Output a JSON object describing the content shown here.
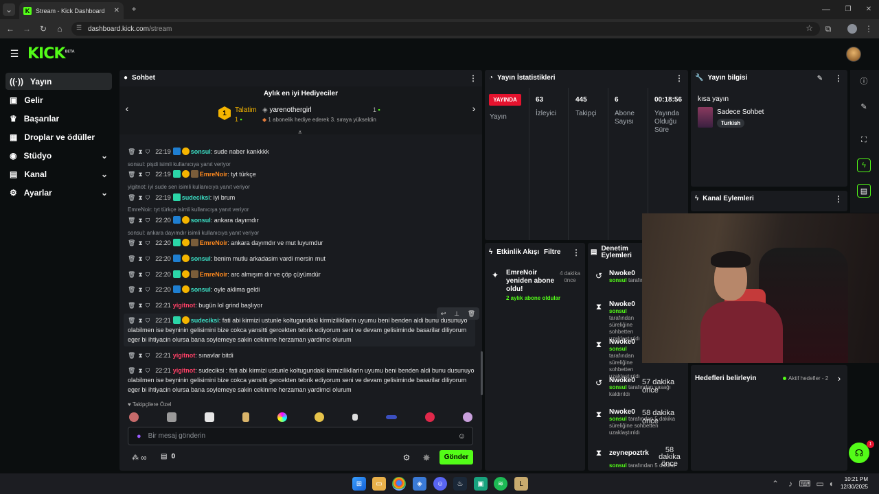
{
  "browser": {
    "tab_title": "Stream - Kick Dashboard",
    "url_host": "dashboard.kick.com",
    "url_path": "/stream"
  },
  "app": {
    "logo": "KICK",
    "logo_tag": "BETA"
  },
  "sidebar": {
    "items": [
      {
        "label": "Yayın",
        "icon": "broadcast-icon"
      },
      {
        "label": "Gelir",
        "icon": "revenue-icon"
      },
      {
        "label": "Başarılar",
        "icon": "trophy-icon"
      },
      {
        "label": "Droplar ve ödüller",
        "icon": "gift-icon"
      },
      {
        "label": "Stüdyo",
        "icon": "studio-icon"
      },
      {
        "label": "Kanal",
        "icon": "channel-icon"
      },
      {
        "label": "Ayarlar",
        "icon": "gear-icon"
      }
    ]
  },
  "chat": {
    "title": "Sohbet",
    "gifters_title": "Aylık en iyi Hediyeciler",
    "gifter1_name": "Talatim",
    "gifter1_count": "1",
    "gifter1_rank": "1",
    "gifter2_name": "yarenothergirl",
    "gifter2_count": "1",
    "gifter2_note": "1 abonelik hediye ederek 3. sıraya yükseldin",
    "messages": [
      {
        "time": "22:19",
        "user": "sonsul",
        "color": "teal",
        "text": ": sude naber kankkkk"
      },
      {
        "reply": "sonsul: pişdi isimli kullanıcıya yanıt veriyor"
      },
      {
        "time": "22:19",
        "user": "EmreNoir",
        "color": "orange",
        "text": ": tyt türkçe"
      },
      {
        "reply": "yigitnot: iyi sude sen isimli kullanıcıya yanıt veriyor"
      },
      {
        "time": "22:19",
        "user": "sudeciksi",
        "color": "teal",
        "text": ": iyi brum"
      },
      {
        "reply": "EmreNoir: tyt türkçe isimli kullanıcıya yanıt veriyor"
      },
      {
        "time": "22:20",
        "user": "sonsul",
        "color": "teal",
        "text": ": ankara dayımdır"
      },
      {
        "reply": "sonsul: ankara dayımdır isimli kullanıcıya yanıt veriyor"
      },
      {
        "time": "22:20",
        "user": "EmreNoir",
        "color": "orange",
        "text": ": ankara dayımdır ve mut luyumdur"
      },
      {
        "time": "22:20",
        "user": "sonsul",
        "color": "teal",
        "text": ": benim mutlu arkadasim vardi mersin mut"
      },
      {
        "time": "22:20",
        "user": "EmreNoir",
        "color": "orange",
        "text": ": arc almışım dır ve çöp çüyümdür"
      },
      {
        "time": "22:20",
        "user": "sonsul",
        "color": "teal",
        "text": ": oyle aklima geldi"
      },
      {
        "time": "22:21",
        "user": "yigitnot",
        "color": "red",
        "text": ": bugün lol grind başlıyor"
      },
      {
        "time": "22:21",
        "user": "sudeciksi",
        "color": "teal",
        "text": ": fati abi kirmizi ustunle koltugundaki kirmizilikllarin uyumu beni benden aldi bunu dusunuyo olabilmen ise beyninin gelisimini bize cokca yansitti gercekten tebrik ediyorum seni ve devam gelisiminde basarilar diliyorum eger bi ihtiyacin olursa bana soylemeye sakin cekinme herzaman yardimci olurum"
      },
      {
        "time": "22:21",
        "user": "yigitnot",
        "color": "red",
        "text": ": sınavlar bitdi"
      },
      {
        "time": "22:21",
        "user": "yigitnot",
        "color": "red",
        "text": ": sudeciksi : fati abi kirmizi ustunle koltugundaki kirmizilikllarin uyumu beni benden aldi bunu dusunuyo olabilmen ise beyninin gelisimini bize cokca yansitti gercekten tebrik ediyorum seni ve devam gelisiminde basarilar diliyorum eger bi ihtiyacin olursa bana soylemeye sakin cekinme herzaman yardimci olurum"
      }
    ],
    "emote_section": "Takipçilere Özel",
    "input_placeholder": "Bir mesaj gönderin",
    "points": "∞",
    "store_count": "0",
    "send_label": "Gönder"
  },
  "stats": {
    "title": "Yayın İstatistikleri",
    "live_label": "YAYINDA",
    "live_sub": "Yayın",
    "viewers_value": "63",
    "viewers_label": "İzleyici",
    "followers_value": "445",
    "followers_label": "Takipçi",
    "subs_value": "6",
    "subs_label": "Abone Sayısı",
    "uptime_value": "00:18:56",
    "uptime_label": "Yayında Olduğu Süre"
  },
  "stream_info": {
    "title": "Yayın bilgisi",
    "stream_title": "kısa yayın",
    "category": "Sadece Sohbet",
    "language": "Turkish"
  },
  "activity": {
    "title": "Etkinlik Akışı",
    "filter_label": "Filtre",
    "event_user": "EmreNoir",
    "event_text": "yeniden abone oldu!",
    "event_sub": "2 aylık abone oldular",
    "event_time": "4 dakika önce"
  },
  "moderation": {
    "title": "Denetim Eylemleri",
    "items": [
      {
        "name": "Nwoke0",
        "text_user": "sonsul",
        "text": "tarafından kaldırıldı",
        "when": ""
      },
      {
        "name": "Nwoke0",
        "text_user": "sonsul",
        "text": "tarafından süreliğine sohbetten uzaklaştırıldı",
        "when": ""
      },
      {
        "name": "Nwoke0",
        "text_user": "sonsul",
        "text": "tarafından süreliğine sohbetten uzaklaştırıldı",
        "when": ""
      },
      {
        "name": "Nwoke0",
        "text_user": "sonsul",
        "text": "tarafından yasağı kaldırıldı",
        "when": "57 dakika önce"
      },
      {
        "name": "Nwoke0",
        "text_user": "sonsul",
        "text": "tarafından 5 dakika süreliğine sohbetten uzaklaştırıldı",
        "when": "58 dakika önce"
      },
      {
        "name": "zeynepoztrk",
        "text_user": "sonsul",
        "text": "tarafından 5 dakika",
        "when": "58 dakika önce"
      }
    ]
  },
  "channel_actions": {
    "title": "Kanal Eylemleri"
  },
  "goals": {
    "label": "Hedefleri belirleyin",
    "active": "Aktif hedefler - 2"
  },
  "support_badge": "1",
  "taskbar": {
    "time": "10:21 PM",
    "date": "12/30/2025"
  },
  "colors": {
    "brand": "#53fc18",
    "live": "#e5132e",
    "panel": "#191b1f"
  }
}
